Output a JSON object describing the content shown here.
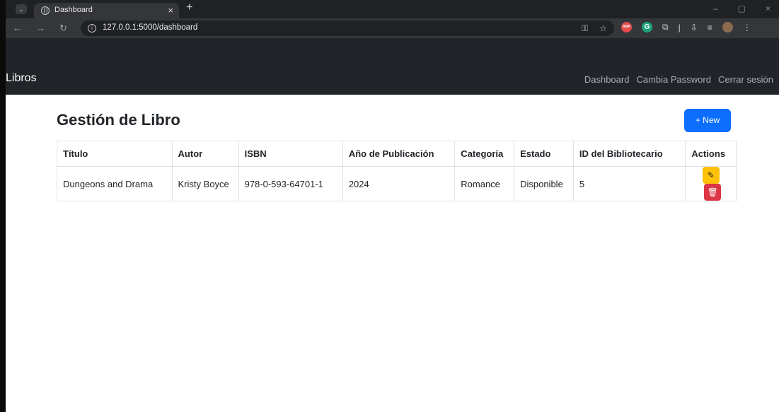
{
  "browser": {
    "tab_title": "Dashboard",
    "url": "127.0.0.1:5000/dashboard"
  },
  "navbar": {
    "brand": "Libros",
    "links": [
      "Dashboard",
      "Cambia Password",
      "Cerrar sesión"
    ]
  },
  "page": {
    "title": "Gestión de Libro",
    "new_label": "+ New"
  },
  "table": {
    "headers": [
      "Título",
      "Autor",
      "ISBN",
      "Año de Publicación",
      "Categoría",
      "Estado",
      "ID del Bibliotecario",
      "Actions"
    ],
    "rows": [
      [
        "Dungeons and Drama",
        "Kristy Boyce",
        "978-0-593-64701-1",
        "2024",
        "Romance",
        "Disponible",
        "5"
      ]
    ]
  },
  "colors": {
    "primary": "#0d6efd",
    "warning": "#ffc107",
    "danger": "#dc3545",
    "navbar": "#212529"
  },
  "icons": {
    "edit": "pencil-icon",
    "delete": "trash-icon"
  }
}
